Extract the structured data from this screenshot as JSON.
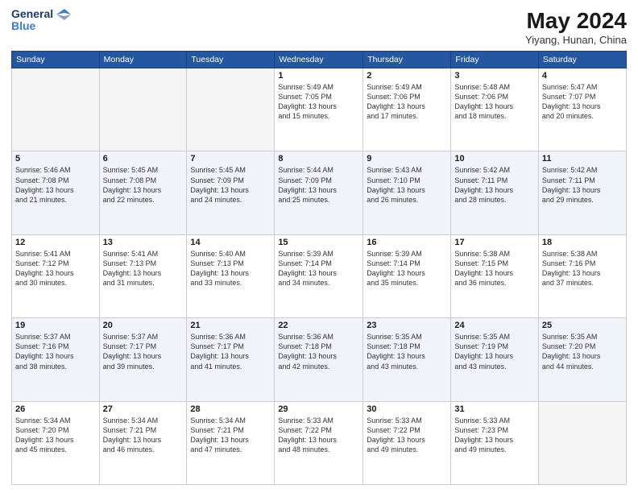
{
  "logo": {
    "line1": "General",
    "line2": "Blue"
  },
  "title": "May 2024",
  "location": "Yiyang, Hunan, China",
  "days_of_week": [
    "Sunday",
    "Monday",
    "Tuesday",
    "Wednesday",
    "Thursday",
    "Friday",
    "Saturday"
  ],
  "weeks": [
    [
      {
        "day": "",
        "info": ""
      },
      {
        "day": "",
        "info": ""
      },
      {
        "day": "",
        "info": ""
      },
      {
        "day": "1",
        "info": "Sunrise: 5:49 AM\nSunset: 7:05 PM\nDaylight: 13 hours\nand 15 minutes."
      },
      {
        "day": "2",
        "info": "Sunrise: 5:49 AM\nSunset: 7:06 PM\nDaylight: 13 hours\nand 17 minutes."
      },
      {
        "day": "3",
        "info": "Sunrise: 5:48 AM\nSunset: 7:06 PM\nDaylight: 13 hours\nand 18 minutes."
      },
      {
        "day": "4",
        "info": "Sunrise: 5:47 AM\nSunset: 7:07 PM\nDaylight: 13 hours\nand 20 minutes."
      }
    ],
    [
      {
        "day": "5",
        "info": "Sunrise: 5:46 AM\nSunset: 7:08 PM\nDaylight: 13 hours\nand 21 minutes."
      },
      {
        "day": "6",
        "info": "Sunrise: 5:45 AM\nSunset: 7:08 PM\nDaylight: 13 hours\nand 22 minutes."
      },
      {
        "day": "7",
        "info": "Sunrise: 5:45 AM\nSunset: 7:09 PM\nDaylight: 13 hours\nand 24 minutes."
      },
      {
        "day": "8",
        "info": "Sunrise: 5:44 AM\nSunset: 7:09 PM\nDaylight: 13 hours\nand 25 minutes."
      },
      {
        "day": "9",
        "info": "Sunrise: 5:43 AM\nSunset: 7:10 PM\nDaylight: 13 hours\nand 26 minutes."
      },
      {
        "day": "10",
        "info": "Sunrise: 5:42 AM\nSunset: 7:11 PM\nDaylight: 13 hours\nand 28 minutes."
      },
      {
        "day": "11",
        "info": "Sunrise: 5:42 AM\nSunset: 7:11 PM\nDaylight: 13 hours\nand 29 minutes."
      }
    ],
    [
      {
        "day": "12",
        "info": "Sunrise: 5:41 AM\nSunset: 7:12 PM\nDaylight: 13 hours\nand 30 minutes."
      },
      {
        "day": "13",
        "info": "Sunrise: 5:41 AM\nSunset: 7:13 PM\nDaylight: 13 hours\nand 31 minutes."
      },
      {
        "day": "14",
        "info": "Sunrise: 5:40 AM\nSunset: 7:13 PM\nDaylight: 13 hours\nand 33 minutes."
      },
      {
        "day": "15",
        "info": "Sunrise: 5:39 AM\nSunset: 7:14 PM\nDaylight: 13 hours\nand 34 minutes."
      },
      {
        "day": "16",
        "info": "Sunrise: 5:39 AM\nSunset: 7:14 PM\nDaylight: 13 hours\nand 35 minutes."
      },
      {
        "day": "17",
        "info": "Sunrise: 5:38 AM\nSunset: 7:15 PM\nDaylight: 13 hours\nand 36 minutes."
      },
      {
        "day": "18",
        "info": "Sunrise: 5:38 AM\nSunset: 7:16 PM\nDaylight: 13 hours\nand 37 minutes."
      }
    ],
    [
      {
        "day": "19",
        "info": "Sunrise: 5:37 AM\nSunset: 7:16 PM\nDaylight: 13 hours\nand 38 minutes."
      },
      {
        "day": "20",
        "info": "Sunrise: 5:37 AM\nSunset: 7:17 PM\nDaylight: 13 hours\nand 39 minutes."
      },
      {
        "day": "21",
        "info": "Sunrise: 5:36 AM\nSunset: 7:17 PM\nDaylight: 13 hours\nand 41 minutes."
      },
      {
        "day": "22",
        "info": "Sunrise: 5:36 AM\nSunset: 7:18 PM\nDaylight: 13 hours\nand 42 minutes."
      },
      {
        "day": "23",
        "info": "Sunrise: 5:35 AM\nSunset: 7:18 PM\nDaylight: 13 hours\nand 43 minutes."
      },
      {
        "day": "24",
        "info": "Sunrise: 5:35 AM\nSunset: 7:19 PM\nDaylight: 13 hours\nand 43 minutes."
      },
      {
        "day": "25",
        "info": "Sunrise: 5:35 AM\nSunset: 7:20 PM\nDaylight: 13 hours\nand 44 minutes."
      }
    ],
    [
      {
        "day": "26",
        "info": "Sunrise: 5:34 AM\nSunset: 7:20 PM\nDaylight: 13 hours\nand 45 minutes."
      },
      {
        "day": "27",
        "info": "Sunrise: 5:34 AM\nSunset: 7:21 PM\nDaylight: 13 hours\nand 46 minutes."
      },
      {
        "day": "28",
        "info": "Sunrise: 5:34 AM\nSunset: 7:21 PM\nDaylight: 13 hours\nand 47 minutes."
      },
      {
        "day": "29",
        "info": "Sunrise: 5:33 AM\nSunset: 7:22 PM\nDaylight: 13 hours\nand 48 minutes."
      },
      {
        "day": "30",
        "info": "Sunrise: 5:33 AM\nSunset: 7:22 PM\nDaylight: 13 hours\nand 49 minutes."
      },
      {
        "day": "31",
        "info": "Sunrise: 5:33 AM\nSunset: 7:23 PM\nDaylight: 13 hours\nand 49 minutes."
      },
      {
        "day": "",
        "info": ""
      }
    ]
  ]
}
